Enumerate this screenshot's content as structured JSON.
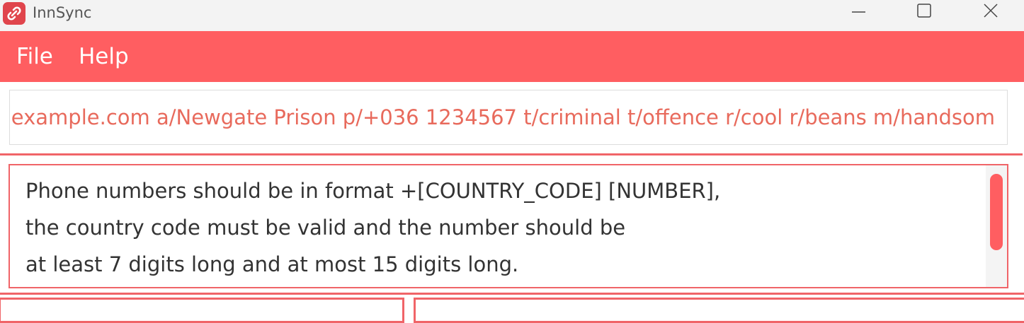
{
  "window": {
    "title": "InnSync",
    "app_icon": "link-rings-icon",
    "controls": [
      "minimize-icon",
      "maximize-icon",
      "close-icon"
    ]
  },
  "menu": {
    "items": [
      {
        "label": "File"
      },
      {
        "label": "Help"
      }
    ]
  },
  "command": {
    "value": "example.com a/Newgate Prison p/+036 1234567 t/criminal t/offence r/cool r/beans m/handsom"
  },
  "result": {
    "lines": [
      "Phone numbers should be in format +[COUNTRY_CODE] [NUMBER],",
      "the country code must be valid and the number should be",
      "at least 7 digits long and at most 15 digits long."
    ]
  },
  "colors": {
    "accent": "#ff5e61",
    "border": "#f06468",
    "command_text": "#e86a5c",
    "titlebar": "#f3f3f3"
  }
}
